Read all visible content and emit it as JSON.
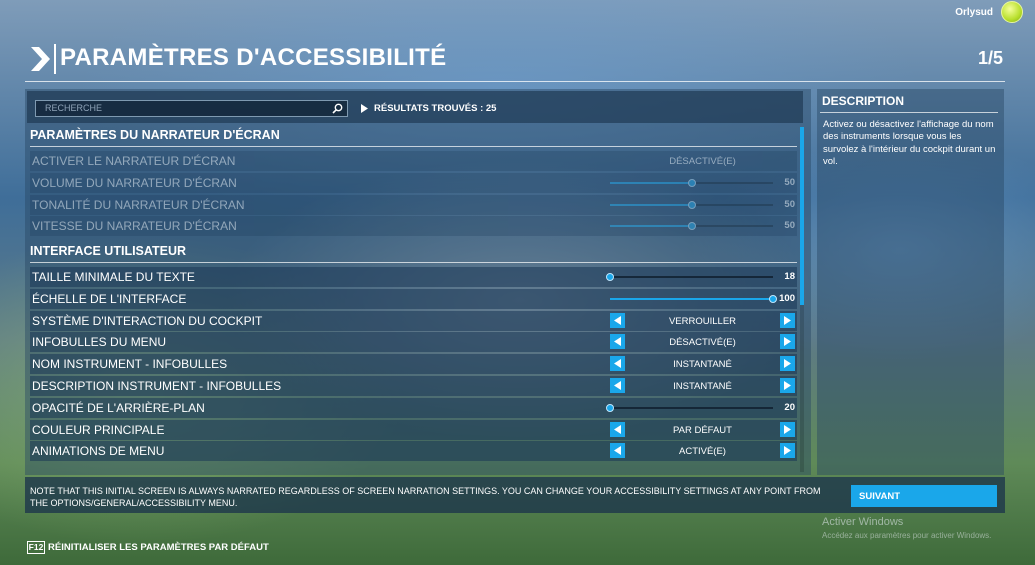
{
  "top": {
    "user_name": "Orlysud"
  },
  "header": {
    "title": "PARAMÈTRES D'ACCESSIBILITÉ",
    "page_counter": "1/5"
  },
  "search": {
    "placeholder": "RECHERCHE",
    "results_label": "RÉSULTATS TROUVÉS : 25"
  },
  "sections": [
    {
      "title": "PARAMÈTRES DU NARRATEUR D'ÉCRAN",
      "rows": [
        {
          "label": "ACTIVER LE NARRATEUR D'ÉCRAN",
          "kind": "text",
          "value": "DÉSACTIVÉ(E)",
          "disabled": true
        },
        {
          "label": "VOLUME DU NARRATEUR D'ÉCRAN",
          "kind": "slider",
          "value": "50",
          "fraction": 0.5,
          "disabled": true
        },
        {
          "label": "TONALITÉ DU NARRATEUR D'ÉCRAN",
          "kind": "slider",
          "value": "50",
          "fraction": 0.5,
          "disabled": true
        },
        {
          "label": "VITESSE DU NARRATEUR D'ÉCRAN",
          "kind": "slider",
          "value": "50",
          "fraction": 0.5,
          "disabled": true
        }
      ]
    },
    {
      "title": "INTERFACE UTILISATEUR",
      "rows": [
        {
          "label": "TAILLE MINIMALE DU TEXTE",
          "kind": "slider",
          "value": "18",
          "fraction": 0.0
        },
        {
          "label": "ÉCHELLE DE L'INTERFACE",
          "kind": "slider",
          "value": "100",
          "fraction": 1.0
        },
        {
          "label": "SYSTÈME D'INTERACTION DU COCKPIT",
          "kind": "selector",
          "value": "VERROUILLER"
        },
        {
          "label": "INFOBULLES DU MENU",
          "kind": "selector",
          "value": "DÉSACTIVÉ(E)"
        },
        {
          "label": "NOM INSTRUMENT - INFOBULLES",
          "kind": "selector",
          "value": "INSTANTANÉ"
        },
        {
          "label": "DESCRIPTION INSTRUMENT - INFOBULLES",
          "kind": "selector",
          "value": "INSTANTANÉ"
        },
        {
          "label": "OPACITÉ DE L'ARRIÈRE-PLAN",
          "kind": "slider",
          "value": "20",
          "fraction": 0.0
        },
        {
          "label": "COULEUR PRINCIPALE",
          "kind": "selector",
          "value": "PAR DÉFAUT"
        },
        {
          "label": "ANIMATIONS DE MENU",
          "kind": "selector",
          "value": "ACTIVÉ(E)"
        }
      ]
    }
  ],
  "description": {
    "title": "DESCRIPTION",
    "text": "Activez ou désactivez l'affichage du nom des instruments lorsque vous les survolez à l'intérieur du cockpit durant un vol."
  },
  "note": {
    "text": "NOTE THAT THIS INITIAL SCREEN IS ALWAYS NARRATED REGARDLESS OF SCREEN NARRATION SETTINGS. YOU CAN CHANGE YOUR ACCESSIBILITY SETTINGS AT ANY POINT FROM THE OPTIONS/GENERAL/ACCESSIBILITY MENU.",
    "next_label": "SUIVANT"
  },
  "footer": {
    "key": "F12",
    "label": "RÉINITIALISER LES PARAMÈTRES PAR DÉFAUT"
  },
  "watermark": {
    "title": "Activer Windows",
    "subtitle": "Accédez aux paramètres pour activer Windows."
  },
  "colors": {
    "accent": "#1aa7ea"
  }
}
